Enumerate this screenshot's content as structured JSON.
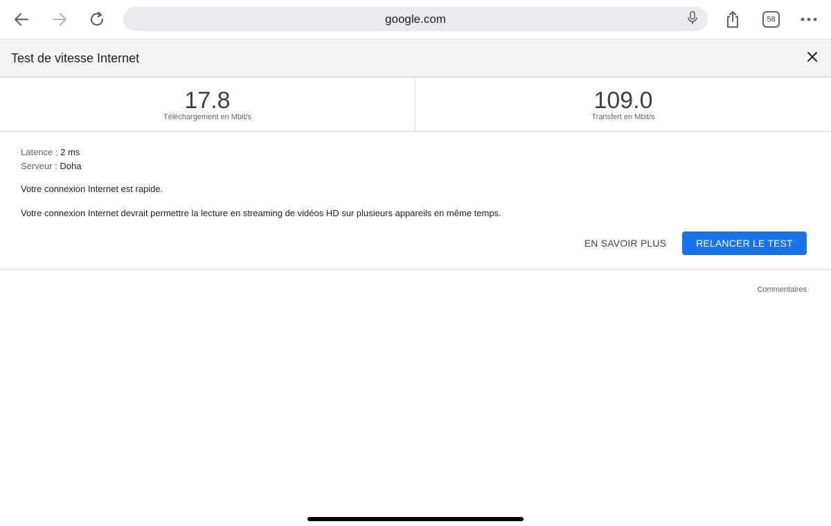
{
  "browser": {
    "url": "google.com",
    "tab_count": "58"
  },
  "panel": {
    "title": "Test de vitesse Internet"
  },
  "results": {
    "download": {
      "value": "17.8",
      "label": "Téléchargement en Mbit/s"
    },
    "upload": {
      "value": "109.0",
      "label": "Transfert en Mbit/s"
    }
  },
  "details": {
    "latency_key": "Latence :",
    "latency_value": "2 ms",
    "server_key": "Serveur :",
    "server_value": "Doha",
    "speed_message": "Votre connexion Internet est rapide.",
    "description": "Votre connexion Internet devrait permettre la lecture en streaming de vidéos HD sur plusieurs appareils en même temps."
  },
  "actions": {
    "learn_more": "EN SAVOIR PLUS",
    "retest": "RELANCER LE TEST"
  },
  "footer": {
    "feedback": "Commentaires"
  },
  "colors": {
    "accent": "#1a73e8",
    "header_bg": "#f1f3f4",
    "address_bg": "#e9ebee"
  },
  "icons": {
    "back": "arrow-left-icon",
    "forward": "arrow-right-icon",
    "reload": "reload-icon",
    "mic": "microphone-icon",
    "share": "share-icon",
    "tabs": "tab-count-icon",
    "more": "more-dots-icon",
    "close": "close-icon"
  }
}
